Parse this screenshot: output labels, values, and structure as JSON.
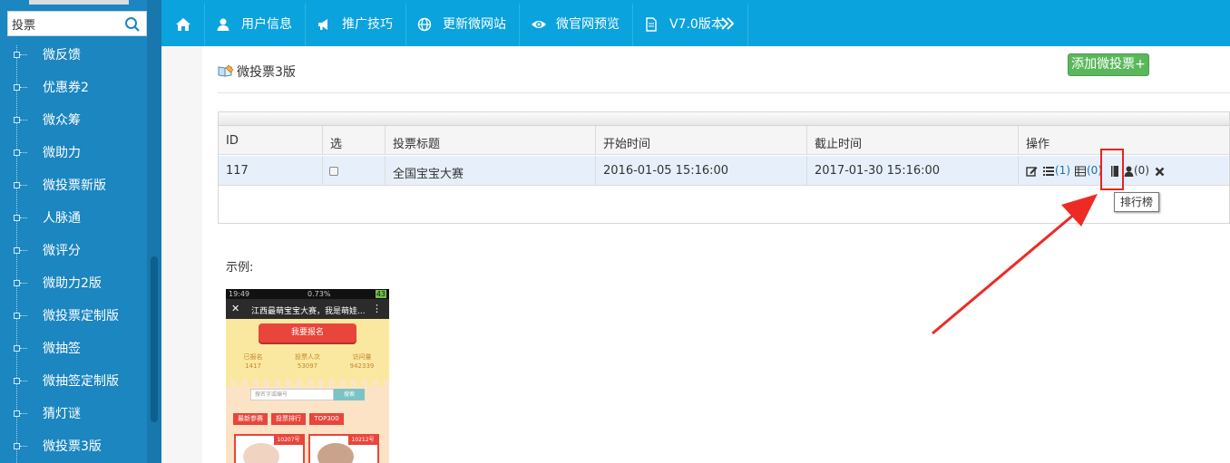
{
  "sidebar": {
    "search": {
      "value": "投票"
    },
    "items": [
      {
        "label": "微反馈"
      },
      {
        "label": "优惠券2"
      },
      {
        "label": "微众筹"
      },
      {
        "label": "微助力"
      },
      {
        "label": "微投票新版"
      },
      {
        "label": "人脉通"
      },
      {
        "label": "微评分"
      },
      {
        "label": "微助力2版"
      },
      {
        "label": "微投票定制版"
      },
      {
        "label": "微抽签"
      },
      {
        "label": "微抽签定制版"
      },
      {
        "label": "猜灯谜"
      },
      {
        "label": "微投票3版"
      }
    ]
  },
  "topnav": {
    "items": [
      {
        "label": "",
        "icon": "home-icon"
      },
      {
        "label": "用户信息",
        "icon": "user-icon"
      },
      {
        "label": "推广技巧",
        "icon": "megaphone-icon"
      },
      {
        "label": "更新微网站",
        "icon": "globe-icon"
      },
      {
        "label": "微官网预览",
        "icon": "eye-icon"
      },
      {
        "label": "V7.0版本",
        "icon": "document-icon"
      }
    ]
  },
  "page": {
    "title": "微投票3版",
    "add_button": "添加微投票+",
    "table": {
      "headers": [
        "ID",
        "选",
        "投票标题",
        "开始时间",
        "截止时间",
        "操作"
      ],
      "rows": [
        {
          "id": "117",
          "title": "全国宝宝大赛",
          "start": "2016-01-05 15:16:00",
          "end": "2017-01-30 15:16:00",
          "ops": {
            "list_count": "(1)",
            "table_count": "(0)",
            "user_count": "(0)"
          }
        }
      ]
    },
    "tooltip": "排行榜",
    "example_label": "示例:"
  },
  "phone": {
    "time": "19:49",
    "battery": "0.73%",
    "signal": "43",
    "title": "江西最萌宝宝大赛，我是萌娃...",
    "signup": "我要报名",
    "stats": [
      {
        "label": "已报名",
        "value": "1417"
      },
      {
        "label": "投票人次",
        "value": "53097"
      },
      {
        "label": "访问量",
        "value": "942339"
      }
    ],
    "search_placeholder": "搜名字或编号",
    "search_btn": "搜索",
    "tabs": [
      "最新参赛",
      "投票排行",
      "TOP300"
    ],
    "cards": [
      "10207号",
      "10212号"
    ]
  },
  "colors": {
    "sidebar": "#1b86c0",
    "topnav": "#0aa3dd",
    "add_button": "#5bb75b",
    "highlight": "#e8231f"
  }
}
